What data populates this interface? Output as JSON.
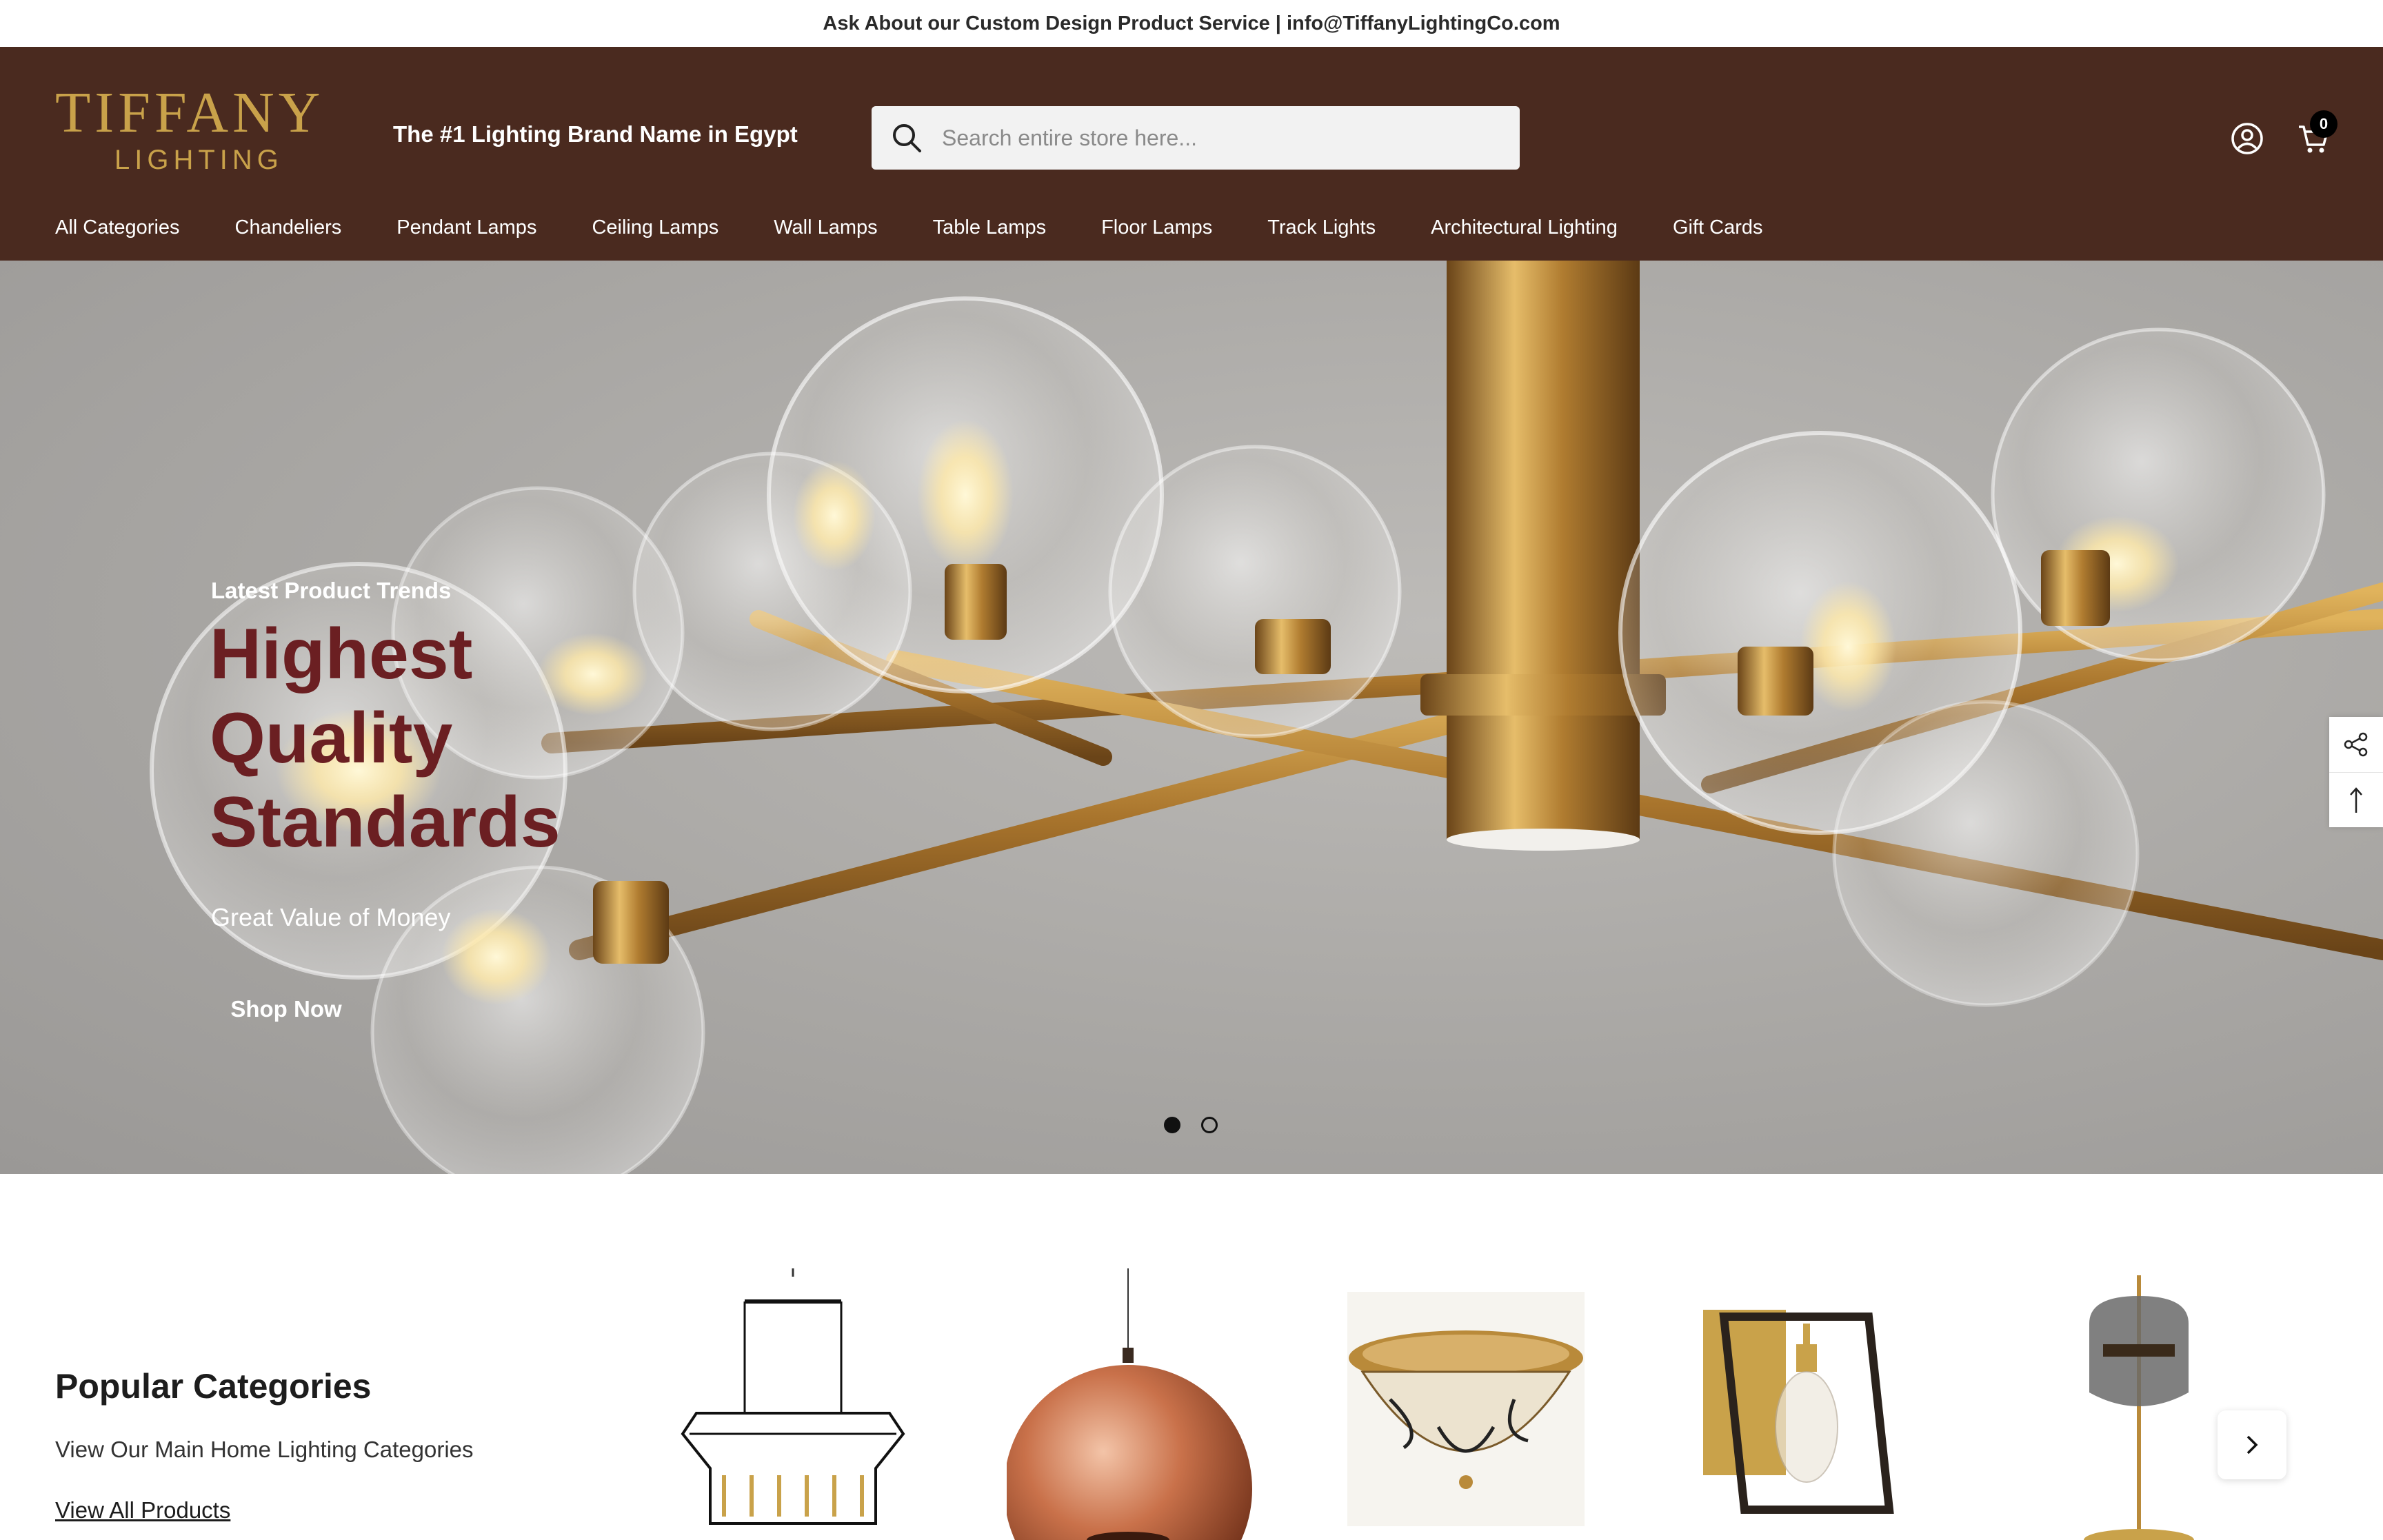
{
  "announcement": "Ask About our Custom Design Product Service | info@TiffanyLightingCo.com",
  "header": {
    "logo_main": "TIFFANY",
    "logo_sub": "LIGHTING",
    "tagline": "The #1 Lighting Brand Name in Egypt",
    "search_placeholder": "Search entire store here...",
    "cart_count": "0",
    "icons": [
      "search-icon",
      "account-icon",
      "cart-icon"
    ]
  },
  "nav": [
    "All Categories",
    "Chandeliers",
    "Pendant Lamps",
    "Ceiling Lamps",
    "Wall Lamps",
    "Table Lamps",
    "Floor Lamps",
    "Track Lights",
    "Architectural Lighting",
    "Gift Cards"
  ],
  "hero": {
    "eyebrow": "Latest Product Trends",
    "title": "Highest Quality Standards",
    "subtitle": "Great Value of Money",
    "button": "Shop Now",
    "slides": 2,
    "active_slide": 1
  },
  "popular": {
    "title": "Popular Categories",
    "subtitle": "View Our Main Home Lighting Categories",
    "link": "View All Products",
    "items": [
      "linear-chandelier",
      "copper-pendant",
      "ceiling-flush-mount",
      "wall-lantern",
      "table-lamp"
    ]
  },
  "colors": {
    "header_bg": "#4a2a1f",
    "logo_gold": "#c9a24a",
    "hero_title": "#6b1f22"
  }
}
